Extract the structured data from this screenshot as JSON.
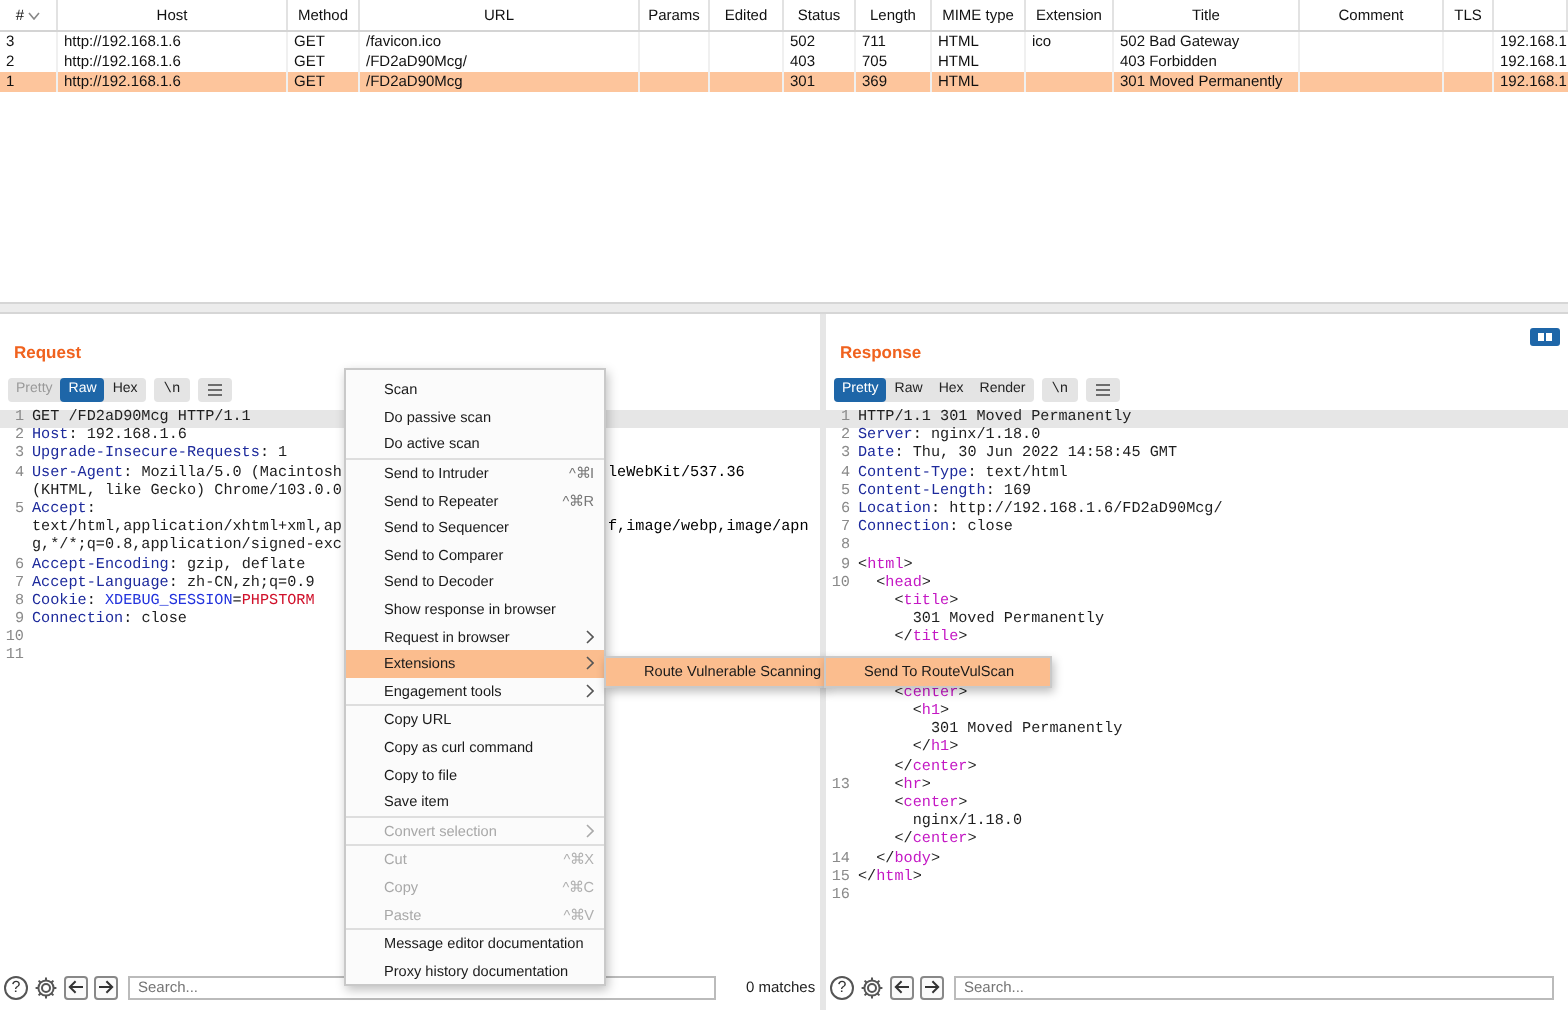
{
  "table": {
    "columns": [
      "#",
      "Host",
      "Method",
      "URL",
      "Params",
      "Edited",
      "Status",
      "Length",
      "MIME type",
      "Extension",
      "Title",
      "Comment",
      "TLS"
    ],
    "rows": [
      {
        "number": "3",
        "host": "http://192.168.1.6",
        "method": "GET",
        "url": "/favicon.ico",
        "status": "502",
        "length": "711",
        "mime_type": "HTML",
        "extension": "ico",
        "title": "502 Bad Gateway",
        "column_14": "192.168.1.",
        "selected": false
      },
      {
        "number": "2",
        "host": "http://192.168.1.6",
        "method": "GET",
        "url": "/FD2aD90Mcg/",
        "status": "403",
        "length": "705",
        "mime_type": "HTML",
        "title": "403 Forbidden",
        "column_14": "192.168.1.",
        "selected": false
      },
      {
        "number": "1",
        "host": "http://192.168.1.6",
        "method": "GET",
        "url": "/FD2aD90Mcg",
        "status": "301",
        "length": "369",
        "mime_type": "HTML",
        "title": "301 Moved Permanently",
        "column_14": "192.168.1.",
        "selected": true
      }
    ]
  },
  "request": {
    "title": "Request",
    "view_tabs": [
      {
        "label": "Pretty",
        "selected": false,
        "disabled": true
      },
      {
        "label": "Raw",
        "selected": true,
        "disabled": false
      },
      {
        "label": "Hex",
        "selected": false,
        "disabled": false
      }
    ],
    "newline_toggle": "\\n",
    "lines": [
      {
        "number": "1",
        "highlighted": true,
        "parts": [
          {
            "text": "GET /FD2aD90Mcg HTTP/1.1",
            "kind": "plain"
          }
        ]
      },
      {
        "number": "2",
        "highlighted": false,
        "parts": [
          {
            "text": "Host",
            "kind": "key"
          },
          {
            "text": ": 192.168.1.6",
            "kind": "plain"
          }
        ]
      },
      {
        "number": "3",
        "highlighted": false,
        "parts": [
          {
            "text": "Upgrade-Insecure-Requests",
            "kind": "key"
          },
          {
            "text": ": 1",
            "kind": "plain"
          }
        ]
      },
      {
        "number": "4",
        "highlighted": false,
        "parts": [
          {
            "text": "User-Agent",
            "kind": "key"
          },
          {
            "text": ": Mozilla/5.0 (Macintosh",
            "kind": "plain"
          }
        ],
        "after_menu": "leWebKit/537.36"
      },
      {
        "highlighted": false,
        "parts": [
          {
            "text": "(KHTML, like Gecko) Chrome/103.0.0",
            "kind": "plain"
          }
        ]
      },
      {
        "number": "5",
        "highlighted": false,
        "parts": [
          {
            "text": "Accept",
            "kind": "key"
          },
          {
            "text": ":",
            "kind": "plain"
          }
        ]
      },
      {
        "highlighted": false,
        "parts": [
          {
            "text": "text/html,application/xhtml+xml,ap",
            "kind": "plain"
          }
        ],
        "after_menu": "f,image/webp,image/apn"
      },
      {
        "highlighted": false,
        "parts": [
          {
            "text": "g,*/*;q=0.8,application/signed-exc",
            "kind": "plain"
          }
        ]
      },
      {
        "number": "6",
        "highlighted": false,
        "parts": [
          {
            "text": "Accept-Encoding",
            "kind": "key"
          },
          {
            "text": ": gzip, deflate",
            "kind": "plain"
          }
        ]
      },
      {
        "number": "7",
        "highlighted": false,
        "parts": [
          {
            "text": "Accept-Language",
            "kind": "key"
          },
          {
            "text": ": zh-CN,zh;q=0.9",
            "kind": "plain"
          }
        ]
      },
      {
        "number": "8",
        "highlighted": false,
        "parts": [
          {
            "text": "Cookie",
            "kind": "key"
          },
          {
            "text": ": ",
            "kind": "plain"
          },
          {
            "text": "XDEBUG_SESSION",
            "kind": "cookie_name"
          },
          {
            "text": "=",
            "kind": "plain"
          },
          {
            "text": "PHPSTORM",
            "kind": "cookie_value"
          }
        ]
      },
      {
        "number": "9",
        "highlighted": false,
        "parts": [
          {
            "text": "Connection",
            "kind": "key"
          },
          {
            "text": ": close",
            "kind": "plain"
          }
        ]
      },
      {
        "number": "10",
        "highlighted": false
      },
      {
        "number": "11",
        "highlighted": false
      }
    ],
    "help": "?",
    "search": {
      "placeholder": "Search..."
    },
    "matches": "0 matches"
  },
  "response": {
    "title": "Response",
    "view_tabs": [
      {
        "label": "Pretty",
        "selected": true,
        "disabled": false
      },
      {
        "label": "Raw",
        "selected": false,
        "disabled": false
      },
      {
        "label": "Hex",
        "selected": false,
        "disabled": false
      },
      {
        "label": "Render",
        "selected": false,
        "disabled": false
      }
    ],
    "newline_toggle": "\\n",
    "lines": [
      {
        "number": "1",
        "highlighted": true,
        "parts": [
          {
            "text": "HTTP/1.1 301 Moved Permanently",
            "kind": "plain"
          }
        ]
      },
      {
        "number": "2",
        "highlighted": false,
        "parts": [
          {
            "text": "Server",
            "kind": "key"
          },
          {
            "text": ": nginx/1.18.0",
            "kind": "plain"
          }
        ]
      },
      {
        "number": "3",
        "highlighted": false,
        "parts": [
          {
            "text": "Date",
            "kind": "key"
          },
          {
            "text": ": Thu, 30 Jun 2022 14:58:45 GMT",
            "kind": "plain"
          }
        ]
      },
      {
        "number": "4",
        "highlighted": false,
        "parts": [
          {
            "text": "Content-Type",
            "kind": "key"
          },
          {
            "text": ": text/html",
            "kind": "plain"
          }
        ]
      },
      {
        "number": "5",
        "highlighted": false,
        "parts": [
          {
            "text": "Content-Length",
            "kind": "key"
          },
          {
            "text": ": 169",
            "kind": "plain"
          }
        ]
      },
      {
        "number": "6",
        "highlighted": false,
        "parts": [
          {
            "text": "Location",
            "kind": "key"
          },
          {
            "text": ": http://192.168.1.6/FD2aD90Mcg/",
            "kind": "plain"
          }
        ]
      },
      {
        "number": "7",
        "highlighted": false,
        "parts": [
          {
            "text": "Connection",
            "kind": "key"
          },
          {
            "text": ": close",
            "kind": "plain"
          }
        ]
      },
      {
        "number": "8",
        "highlighted": false
      },
      {
        "number": "9",
        "highlighted": false,
        "parts": [
          {
            "text": "<",
            "kind": "punct"
          },
          {
            "text": "html",
            "kind": "tag"
          },
          {
            "text": ">",
            "kind": "punct"
          }
        ]
      },
      {
        "number": "10",
        "highlighted": false,
        "parts": [
          {
            "text": "  <",
            "kind": "punct"
          },
          {
            "text": "head",
            "kind": "tag"
          },
          {
            "text": ">",
            "kind": "punct"
          }
        ]
      },
      {
        "highlighted": false,
        "parts": [
          {
            "text": "    <",
            "kind": "punct"
          },
          {
            "text": "title",
            "kind": "tag"
          },
          {
            "text": ">",
            "kind": "punct"
          }
        ]
      },
      {
        "highlighted": false,
        "parts": [
          {
            "text": "      301 Moved Permanently",
            "kind": "plain"
          }
        ]
      },
      {
        "highlighted": false,
        "parts": [
          {
            "text": "    </",
            "kind": "punct"
          },
          {
            "text": "title",
            "kind": "tag"
          },
          {
            "text": ">",
            "kind": "punct"
          }
        ]
      },
      {
        "highlighted": false
      },
      {
        "highlighted": false
      },
      {
        "highlighted": false,
        "parts": [
          {
            "text": "    <",
            "kind": "punct"
          },
          {
            "text": "center",
            "kind": "tag"
          },
          {
            "text": ">",
            "kind": "punct"
          }
        ]
      },
      {
        "highlighted": false,
        "parts": [
          {
            "text": "      <",
            "kind": "punct"
          },
          {
            "text": "h1",
            "kind": "tag"
          },
          {
            "text": ">",
            "kind": "punct"
          }
        ]
      },
      {
        "highlighted": false,
        "parts": [
          {
            "text": "        301 Moved Permanently",
            "kind": "plain"
          }
        ]
      },
      {
        "highlighted": false,
        "parts": [
          {
            "text": "      </",
            "kind": "punct"
          },
          {
            "text": "h1",
            "kind": "tag"
          },
          {
            "text": ">",
            "kind": "punct"
          }
        ]
      },
      {
        "highlighted": false,
        "parts": [
          {
            "text": "    </",
            "kind": "punct"
          },
          {
            "text": "center",
            "kind": "tag"
          },
          {
            "text": ">",
            "kind": "punct"
          }
        ]
      },
      {
        "number": "13",
        "highlighted": false,
        "parts": [
          {
            "text": "    <",
            "kind": "punct"
          },
          {
            "text": "hr",
            "kind": "tag"
          },
          {
            "text": ">",
            "kind": "punct"
          }
        ]
      },
      {
        "highlighted": false,
        "parts": [
          {
            "text": "    <",
            "kind": "punct"
          },
          {
            "text": "center",
            "kind": "tag"
          },
          {
            "text": ">",
            "kind": "punct"
          }
        ]
      },
      {
        "highlighted": false,
        "parts": [
          {
            "text": "      nginx/1.18.0",
            "kind": "plain"
          }
        ]
      },
      {
        "highlighted": false,
        "parts": [
          {
            "text": "    </",
            "kind": "punct"
          },
          {
            "text": "center",
            "kind": "tag"
          },
          {
            "text": ">",
            "kind": "punct"
          }
        ]
      },
      {
        "number": "14",
        "highlighted": false,
        "parts": [
          {
            "text": "  </",
            "kind": "punct"
          },
          {
            "text": "body",
            "kind": "tag"
          },
          {
            "text": ">",
            "kind": "punct"
          }
        ]
      },
      {
        "number": "15",
        "highlighted": false,
        "parts": [
          {
            "text": "</",
            "kind": "punct"
          },
          {
            "text": "html",
            "kind": "tag"
          },
          {
            "text": ">",
            "kind": "punct"
          }
        ]
      },
      {
        "number": "16",
        "highlighted": false
      }
    ],
    "help": "?",
    "search": {
      "placeholder": "Search..."
    }
  },
  "context_menu": {
    "groups": [
      [
        {
          "label": "Scan",
          "selected": false,
          "disabled": false,
          "has_submenu": false
        },
        {
          "label": "Do passive scan",
          "selected": false,
          "disabled": false,
          "has_submenu": false
        },
        {
          "label": "Do active scan",
          "selected": false,
          "disabled": false,
          "has_submenu": false
        }
      ],
      [
        {
          "label": "Send to Intruder",
          "shortcut": "^⌘I",
          "selected": false,
          "disabled": false,
          "has_submenu": false
        },
        {
          "label": "Send to Repeater",
          "shortcut": "^⌘R",
          "selected": false,
          "disabled": false,
          "has_submenu": false
        },
        {
          "label": "Send to Sequencer",
          "selected": false,
          "disabled": false,
          "has_submenu": false
        },
        {
          "label": "Send to Comparer",
          "selected": false,
          "disabled": false,
          "has_submenu": false
        },
        {
          "label": "Send to Decoder",
          "selected": false,
          "disabled": false,
          "has_submenu": false
        },
        {
          "label": "Show response in browser",
          "selected": false,
          "disabled": false,
          "has_submenu": false
        },
        {
          "label": "Request in browser",
          "selected": false,
          "disabled": false,
          "has_submenu": true
        },
        {
          "label": "Extensions",
          "selected": true,
          "disabled": false,
          "has_submenu": true
        },
        {
          "label": "Engagement tools",
          "selected": false,
          "disabled": false,
          "has_submenu": true
        }
      ],
      [
        {
          "label": "Copy URL",
          "selected": false,
          "disabled": false,
          "has_submenu": false
        },
        {
          "label": "Copy as curl command",
          "selected": false,
          "disabled": false,
          "has_submenu": false
        },
        {
          "label": "Copy to file",
          "selected": false,
          "disabled": false,
          "has_submenu": false
        },
        {
          "label": "Save item",
          "selected": false,
          "disabled": false,
          "has_submenu": false
        }
      ],
      [
        {
          "label": "Convert selection",
          "selected": false,
          "disabled": true,
          "has_submenu": true
        }
      ],
      [
        {
          "label": "Cut",
          "shortcut": "^⌘X",
          "selected": false,
          "disabled": true,
          "has_submenu": false
        },
        {
          "label": "Copy",
          "shortcut": "^⌘C",
          "selected": false,
          "disabled": true,
          "has_submenu": false
        },
        {
          "label": "Paste",
          "shortcut": "^⌘V",
          "selected": false,
          "disabled": true,
          "has_submenu": false
        }
      ],
      [
        {
          "label": "Message editor documentation",
          "selected": false,
          "disabled": false,
          "has_submenu": false
        },
        {
          "label": "Proxy history documentation",
          "selected": false,
          "disabled": false,
          "has_submenu": false
        }
      ]
    ]
  },
  "extensions_submenu": {
    "groups": [
      [
        {
          "label": "Route Vulnerable Scanning",
          "selected": true,
          "disabled": false,
          "has_submenu": true
        }
      ]
    ]
  },
  "scanning_submenu": {
    "groups": [
      [
        {
          "label": "Send To RouteVulScan",
          "selected": true,
          "disabled": false,
          "has_submenu": false
        }
      ]
    ]
  }
}
